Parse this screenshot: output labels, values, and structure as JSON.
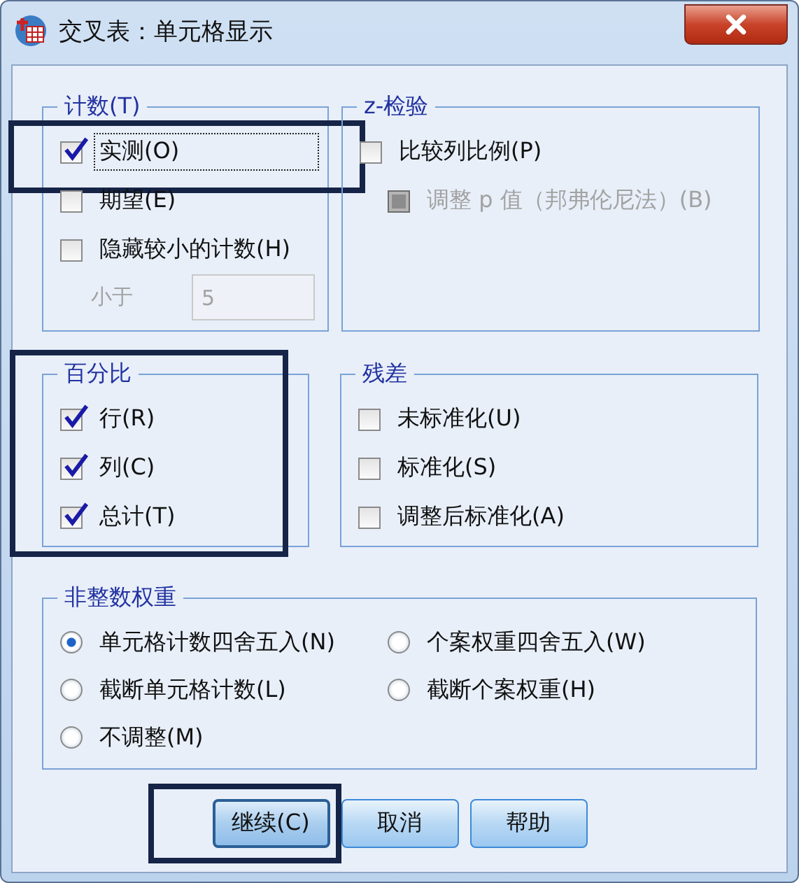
{
  "window": {
    "title": "交叉表：单元格显示"
  },
  "counts": {
    "title": "计数(T)",
    "items": [
      {
        "label": "实测(O)",
        "checked": true,
        "focused": true,
        "highlighted": true
      },
      {
        "label": "期望(E)",
        "checked": false,
        "focused": false,
        "highlighted": false
      },
      {
        "label": "隐藏较小的计数(H)",
        "checked": false,
        "focused": false,
        "highlighted": false
      }
    ],
    "less_than": {
      "label": "小于",
      "value": "5",
      "disabled": true
    }
  },
  "z_test": {
    "title": "z-检验",
    "items": [
      {
        "label": "比较列比例(P)",
        "checked": false,
        "disabled": false,
        "children": [
          {
            "label": "调整 p 值（邦弗伦尼法）(B)",
            "checked": false,
            "disabled": true
          }
        ]
      }
    ]
  },
  "percentages": {
    "title": "百分比",
    "highlighted": true,
    "items": [
      {
        "label": "行(R)",
        "checked": true
      },
      {
        "label": "列(C)",
        "checked": true
      },
      {
        "label": "总计(T)",
        "checked": true
      }
    ]
  },
  "residuals": {
    "title": "残差",
    "items": [
      {
        "label": "未标准化(U)",
        "checked": false
      },
      {
        "label": "标准化(S)",
        "checked": false
      },
      {
        "label": "调整后标准化(A)",
        "checked": false
      }
    ]
  },
  "noninteger_weights": {
    "title": "非整数权重",
    "options": [
      {
        "label": "单元格计数四舍五入(N)",
        "selected": true
      },
      {
        "label": "个案权重四舍五入(W)",
        "selected": false
      },
      {
        "label": "截断单元格计数(L)",
        "selected": false
      },
      {
        "label": "截断个案权重(H)",
        "selected": false
      },
      {
        "label": "不调整(M)",
        "selected": false
      }
    ]
  },
  "buttons": [
    {
      "label": "继续(C)",
      "default": true,
      "highlighted": true
    },
    {
      "label": "取消",
      "default": false,
      "highlighted": false
    },
    {
      "label": "帮助",
      "default": false,
      "highlighted": false
    }
  ]
}
